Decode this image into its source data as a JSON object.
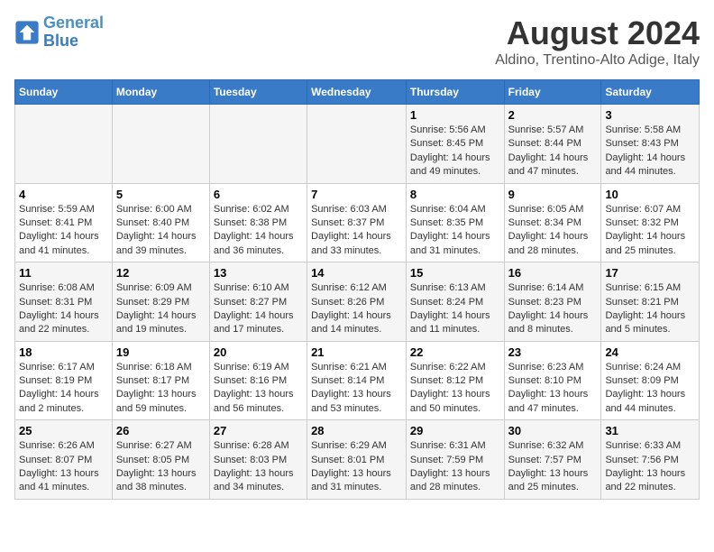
{
  "logo": {
    "line1": "General",
    "line2": "Blue"
  },
  "title": "August 2024",
  "subtitle": "Aldino, Trentino-Alto Adige, Italy",
  "weekdays": [
    "Sunday",
    "Monday",
    "Tuesday",
    "Wednesday",
    "Thursday",
    "Friday",
    "Saturday"
  ],
  "weeks": [
    [
      {
        "day": "",
        "info": ""
      },
      {
        "day": "",
        "info": ""
      },
      {
        "day": "",
        "info": ""
      },
      {
        "day": "",
        "info": ""
      },
      {
        "day": "1",
        "info": "Sunrise: 5:56 AM\nSunset: 8:45 PM\nDaylight: 14 hours and 49 minutes."
      },
      {
        "day": "2",
        "info": "Sunrise: 5:57 AM\nSunset: 8:44 PM\nDaylight: 14 hours and 47 minutes."
      },
      {
        "day": "3",
        "info": "Sunrise: 5:58 AM\nSunset: 8:43 PM\nDaylight: 14 hours and 44 minutes."
      }
    ],
    [
      {
        "day": "4",
        "info": "Sunrise: 5:59 AM\nSunset: 8:41 PM\nDaylight: 14 hours and 41 minutes."
      },
      {
        "day": "5",
        "info": "Sunrise: 6:00 AM\nSunset: 8:40 PM\nDaylight: 14 hours and 39 minutes."
      },
      {
        "day": "6",
        "info": "Sunrise: 6:02 AM\nSunset: 8:38 PM\nDaylight: 14 hours and 36 minutes."
      },
      {
        "day": "7",
        "info": "Sunrise: 6:03 AM\nSunset: 8:37 PM\nDaylight: 14 hours and 33 minutes."
      },
      {
        "day": "8",
        "info": "Sunrise: 6:04 AM\nSunset: 8:35 PM\nDaylight: 14 hours and 31 minutes."
      },
      {
        "day": "9",
        "info": "Sunrise: 6:05 AM\nSunset: 8:34 PM\nDaylight: 14 hours and 28 minutes."
      },
      {
        "day": "10",
        "info": "Sunrise: 6:07 AM\nSunset: 8:32 PM\nDaylight: 14 hours and 25 minutes."
      }
    ],
    [
      {
        "day": "11",
        "info": "Sunrise: 6:08 AM\nSunset: 8:31 PM\nDaylight: 14 hours and 22 minutes."
      },
      {
        "day": "12",
        "info": "Sunrise: 6:09 AM\nSunset: 8:29 PM\nDaylight: 14 hours and 19 minutes."
      },
      {
        "day": "13",
        "info": "Sunrise: 6:10 AM\nSunset: 8:27 PM\nDaylight: 14 hours and 17 minutes."
      },
      {
        "day": "14",
        "info": "Sunrise: 6:12 AM\nSunset: 8:26 PM\nDaylight: 14 hours and 14 minutes."
      },
      {
        "day": "15",
        "info": "Sunrise: 6:13 AM\nSunset: 8:24 PM\nDaylight: 14 hours and 11 minutes."
      },
      {
        "day": "16",
        "info": "Sunrise: 6:14 AM\nSunset: 8:23 PM\nDaylight: 14 hours and 8 minutes."
      },
      {
        "day": "17",
        "info": "Sunrise: 6:15 AM\nSunset: 8:21 PM\nDaylight: 14 hours and 5 minutes."
      }
    ],
    [
      {
        "day": "18",
        "info": "Sunrise: 6:17 AM\nSunset: 8:19 PM\nDaylight: 14 hours and 2 minutes."
      },
      {
        "day": "19",
        "info": "Sunrise: 6:18 AM\nSunset: 8:17 PM\nDaylight: 13 hours and 59 minutes."
      },
      {
        "day": "20",
        "info": "Sunrise: 6:19 AM\nSunset: 8:16 PM\nDaylight: 13 hours and 56 minutes."
      },
      {
        "day": "21",
        "info": "Sunrise: 6:21 AM\nSunset: 8:14 PM\nDaylight: 13 hours and 53 minutes."
      },
      {
        "day": "22",
        "info": "Sunrise: 6:22 AM\nSunset: 8:12 PM\nDaylight: 13 hours and 50 minutes."
      },
      {
        "day": "23",
        "info": "Sunrise: 6:23 AM\nSunset: 8:10 PM\nDaylight: 13 hours and 47 minutes."
      },
      {
        "day": "24",
        "info": "Sunrise: 6:24 AM\nSunset: 8:09 PM\nDaylight: 13 hours and 44 minutes."
      }
    ],
    [
      {
        "day": "25",
        "info": "Sunrise: 6:26 AM\nSunset: 8:07 PM\nDaylight: 13 hours and 41 minutes."
      },
      {
        "day": "26",
        "info": "Sunrise: 6:27 AM\nSunset: 8:05 PM\nDaylight: 13 hours and 38 minutes."
      },
      {
        "day": "27",
        "info": "Sunrise: 6:28 AM\nSunset: 8:03 PM\nDaylight: 13 hours and 34 minutes."
      },
      {
        "day": "28",
        "info": "Sunrise: 6:29 AM\nSunset: 8:01 PM\nDaylight: 13 hours and 31 minutes."
      },
      {
        "day": "29",
        "info": "Sunrise: 6:31 AM\nSunset: 7:59 PM\nDaylight: 13 hours and 28 minutes."
      },
      {
        "day": "30",
        "info": "Sunrise: 6:32 AM\nSunset: 7:57 PM\nDaylight: 13 hours and 25 minutes."
      },
      {
        "day": "31",
        "info": "Sunrise: 6:33 AM\nSunset: 7:56 PM\nDaylight: 13 hours and 22 minutes."
      }
    ]
  ]
}
